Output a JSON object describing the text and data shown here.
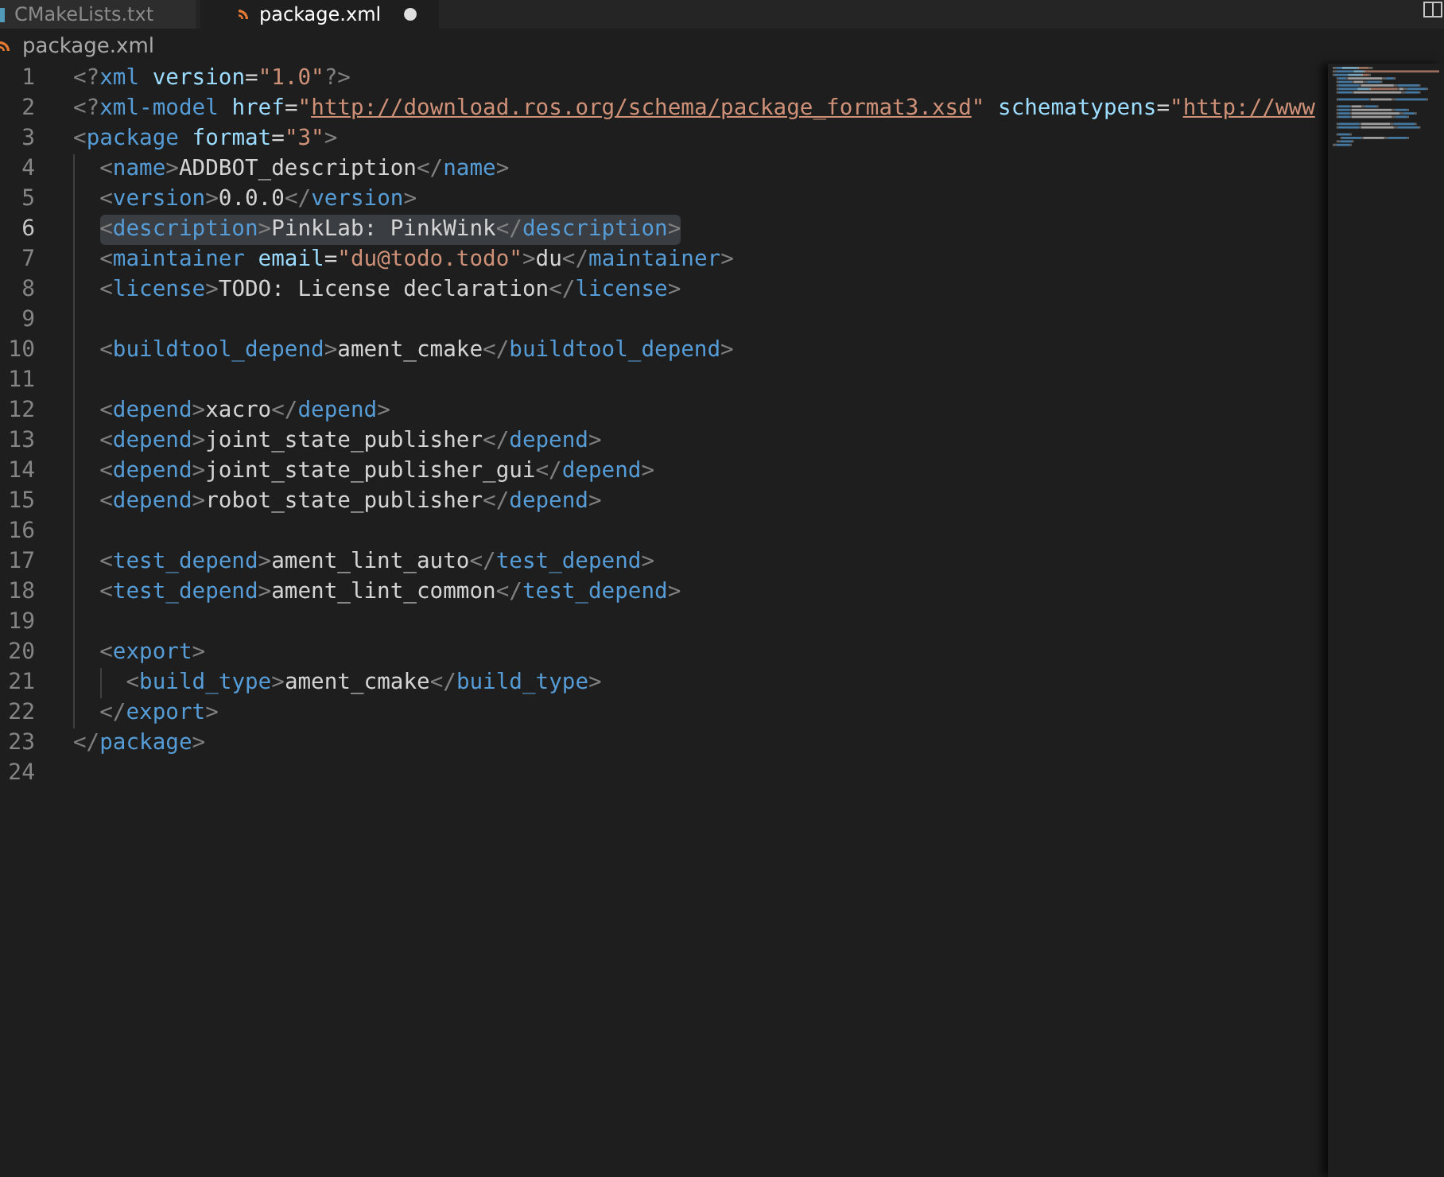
{
  "tabs": [
    {
      "label": "CMakeLists.txt",
      "selected": false,
      "modified": false
    },
    {
      "label": "package.xml",
      "selected": true,
      "modified": true
    }
  ],
  "breadcrumb": {
    "label": "package.xml"
  },
  "editor": {
    "lines": [
      {
        "number": "1",
        "current": false,
        "highlighted": false,
        "tokens": [
          {
            "kind": "punct",
            "text": "<?"
          },
          {
            "kind": "tag",
            "text": "xml"
          },
          {
            "kind": "attr",
            "text": " version"
          },
          {
            "kind": "eq",
            "text": "="
          },
          {
            "kind": "string",
            "text": "\"1.0\""
          },
          {
            "kind": "punct",
            "text": "?>"
          }
        ]
      },
      {
        "number": "2",
        "current": false,
        "highlighted": false,
        "tokens": [
          {
            "kind": "punct",
            "text": "<?"
          },
          {
            "kind": "tag",
            "text": "xml-model"
          },
          {
            "kind": "attr",
            "text": " href"
          },
          {
            "kind": "eq",
            "text": "="
          },
          {
            "kind": "string",
            "text": "\""
          },
          {
            "kind": "link",
            "text": "http://download.ros.org/schema/package_format3.xsd"
          },
          {
            "kind": "string",
            "text": "\""
          },
          {
            "kind": "attr",
            "text": " schematypens"
          },
          {
            "kind": "eq",
            "text": "="
          },
          {
            "kind": "string",
            "text": "\""
          },
          {
            "kind": "link",
            "text": "http://www"
          }
        ]
      },
      {
        "number": "3",
        "current": false,
        "highlighted": false,
        "tokens": [
          {
            "kind": "punct",
            "text": "<"
          },
          {
            "kind": "tag",
            "text": "package"
          },
          {
            "kind": "attr",
            "text": " format"
          },
          {
            "kind": "eq",
            "text": "="
          },
          {
            "kind": "string",
            "text": "\"3\""
          },
          {
            "kind": "punct",
            "text": ">"
          }
        ],
        "children": [
          {
            "number": "4",
            "current": false,
            "highlighted": false,
            "tokens": [
              {
                "kind": "punct",
                "text": "<"
              },
              {
                "kind": "tag",
                "text": "name"
              },
              {
                "kind": "punct",
                "text": ">"
              },
              {
                "kind": "text",
                "text": "ADDBOT_description"
              },
              {
                "kind": "punct",
                "text": "</"
              },
              {
                "kind": "tag",
                "text": "name"
              },
              {
                "kind": "punct",
                "text": ">"
              }
            ]
          },
          {
            "number": "5",
            "current": false,
            "highlighted": false,
            "tokens": [
              {
                "kind": "punct",
                "text": "<"
              },
              {
                "kind": "tag",
                "text": "version"
              },
              {
                "kind": "punct",
                "text": ">"
              },
              {
                "kind": "text",
                "text": "0.0.0"
              },
              {
                "kind": "punct",
                "text": "</"
              },
              {
                "kind": "tag",
                "text": "version"
              },
              {
                "kind": "punct",
                "text": ">"
              }
            ]
          },
          {
            "number": "6",
            "current": true,
            "highlighted": true,
            "tokens": [
              {
                "kind": "punct",
                "text": "<"
              },
              {
                "kind": "tag",
                "text": "description"
              },
              {
                "kind": "punct",
                "text": ">"
              },
              {
                "kind": "text",
                "text": "PinkLab: PinkWink"
              },
              {
                "kind": "punct",
                "text": "</"
              },
              {
                "kind": "tag",
                "text": "description"
              },
              {
                "kind": "punct",
                "text": ">"
              }
            ]
          },
          {
            "number": "7",
            "current": false,
            "highlighted": false,
            "tokens": [
              {
                "kind": "punct",
                "text": "<"
              },
              {
                "kind": "tag",
                "text": "maintainer"
              },
              {
                "kind": "attr",
                "text": " email"
              },
              {
                "kind": "eq",
                "text": "="
              },
              {
                "kind": "string",
                "text": "\"du@todo.todo\""
              },
              {
                "kind": "punct",
                "text": ">"
              },
              {
                "kind": "text",
                "text": "du"
              },
              {
                "kind": "punct",
                "text": "</"
              },
              {
                "kind": "tag",
                "text": "maintainer"
              },
              {
                "kind": "punct",
                "text": ">"
              }
            ]
          },
          {
            "number": "8",
            "current": false,
            "highlighted": false,
            "tokens": [
              {
                "kind": "punct",
                "text": "<"
              },
              {
                "kind": "tag",
                "text": "license"
              },
              {
                "kind": "punct",
                "text": ">"
              },
              {
                "kind": "text",
                "text": "TODO: License declaration"
              },
              {
                "kind": "punct",
                "text": "</"
              },
              {
                "kind": "tag",
                "text": "license"
              },
              {
                "kind": "punct",
                "text": ">"
              }
            ]
          },
          {
            "number": "9",
            "current": false,
            "highlighted": false
          },
          {
            "number": "10",
            "current": false,
            "highlighted": false,
            "tokens": [
              {
                "kind": "punct",
                "text": "<"
              },
              {
                "kind": "tag",
                "text": "buildtool_depend"
              },
              {
                "kind": "punct",
                "text": ">"
              },
              {
                "kind": "text",
                "text": "ament_cmake"
              },
              {
                "kind": "punct",
                "text": "</"
              },
              {
                "kind": "tag",
                "text": "buildtool_depend"
              },
              {
                "kind": "punct",
                "text": ">"
              }
            ]
          },
          {
            "number": "11",
            "current": false,
            "highlighted": false
          },
          {
            "number": "12",
            "current": false,
            "highlighted": false,
            "tokens": [
              {
                "kind": "punct",
                "text": "<"
              },
              {
                "kind": "tag",
                "text": "depend"
              },
              {
                "kind": "punct",
                "text": ">"
              },
              {
                "kind": "text",
                "text": "xacro"
              },
              {
                "kind": "punct",
                "text": "</"
              },
              {
                "kind": "tag",
                "text": "depend"
              },
              {
                "kind": "punct",
                "text": ">"
              }
            ]
          },
          {
            "number": "13",
            "current": false,
            "highlighted": false,
            "tokens": [
              {
                "kind": "punct",
                "text": "<"
              },
              {
                "kind": "tag",
                "text": "depend"
              },
              {
                "kind": "punct",
                "text": ">"
              },
              {
                "kind": "text",
                "text": "joint_state_publisher"
              },
              {
                "kind": "punct",
                "text": "</"
              },
              {
                "kind": "tag",
                "text": "depend"
              },
              {
                "kind": "punct",
                "text": ">"
              }
            ]
          },
          {
            "number": "14",
            "current": false,
            "highlighted": false,
            "tokens": [
              {
                "kind": "punct",
                "text": "<"
              },
              {
                "kind": "tag",
                "text": "depend"
              },
              {
                "kind": "punct",
                "text": ">"
              },
              {
                "kind": "text",
                "text": "joint_state_publisher_gui"
              },
              {
                "kind": "punct",
                "text": "</"
              },
              {
                "kind": "tag",
                "text": "depend"
              },
              {
                "kind": "punct",
                "text": ">"
              }
            ]
          },
          {
            "number": "15",
            "current": false,
            "highlighted": false,
            "tokens": [
              {
                "kind": "punct",
                "text": "<"
              },
              {
                "kind": "tag",
                "text": "depend"
              },
              {
                "kind": "punct",
                "text": ">"
              },
              {
                "kind": "text",
                "text": "robot_state_publisher"
              },
              {
                "kind": "punct",
                "text": "</"
              },
              {
                "kind": "tag",
                "text": "depend"
              },
              {
                "kind": "punct",
                "text": ">"
              }
            ]
          },
          {
            "number": "16",
            "current": false,
            "highlighted": false
          },
          {
            "number": "17",
            "current": false,
            "highlighted": false,
            "tokens": [
              {
                "kind": "punct",
                "text": "<"
              },
              {
                "kind": "tag",
                "text": "test_depend"
              },
              {
                "kind": "punct",
                "text": ">"
              },
              {
                "kind": "text",
                "text": "ament_lint_auto"
              },
              {
                "kind": "punct",
                "text": "</"
              },
              {
                "kind": "tag",
                "text": "test_depend"
              },
              {
                "kind": "punct",
                "text": ">"
              }
            ]
          },
          {
            "number": "18",
            "current": false,
            "highlighted": false,
            "tokens": [
              {
                "kind": "punct",
                "text": "<"
              },
              {
                "kind": "tag",
                "text": "test_depend"
              },
              {
                "kind": "punct",
                "text": ">"
              },
              {
                "kind": "text",
                "text": "ament_lint_common"
              },
              {
                "kind": "punct",
                "text": "</"
              },
              {
                "kind": "tag",
                "text": "test_depend"
              },
              {
                "kind": "punct",
                "text": ">"
              }
            ]
          },
          {
            "number": "19",
            "current": false,
            "highlighted": false
          },
          {
            "number": "20",
            "current": false,
            "highlighted": false,
            "tokens": [
              {
                "kind": "punct",
                "text": "<"
              },
              {
                "kind": "tag",
                "text": "export"
              },
              {
                "kind": "punct",
                "text": ">"
              }
            ],
            "children": [
              {
                "number": "21",
                "current": false,
                "highlighted": false,
                "tokens": [
                  {
                    "kind": "punct",
                    "text": "<"
                  },
                  {
                    "kind": "tag",
                    "text": "build_type"
                  },
                  {
                    "kind": "punct",
                    "text": ">"
                  },
                  {
                    "kind": "text",
                    "text": "ament_cmake"
                  },
                  {
                    "kind": "punct",
                    "text": "</"
                  },
                  {
                    "kind": "tag",
                    "text": "build_type"
                  },
                  {
                    "kind": "punct",
                    "text": ">"
                  }
                ]
              }
            ]
          },
          {
            "number": "22",
            "current": false,
            "highlighted": false,
            "tokens": [
              {
                "kind": "punct",
                "text": "</"
              },
              {
                "kind": "tag",
                "text": "export"
              },
              {
                "kind": "punct",
                "text": ">"
              }
            ]
          }
        ]
      },
      {
        "number": "23",
        "current": false,
        "highlighted": false,
        "tokens": [
          {
            "kind": "punct",
            "text": "</"
          },
          {
            "kind": "tag",
            "text": "package"
          },
          {
            "kind": "punct",
            "text": ">"
          }
        ]
      },
      {
        "number": "24",
        "current": false,
        "highlighted": false
      }
    ]
  }
}
